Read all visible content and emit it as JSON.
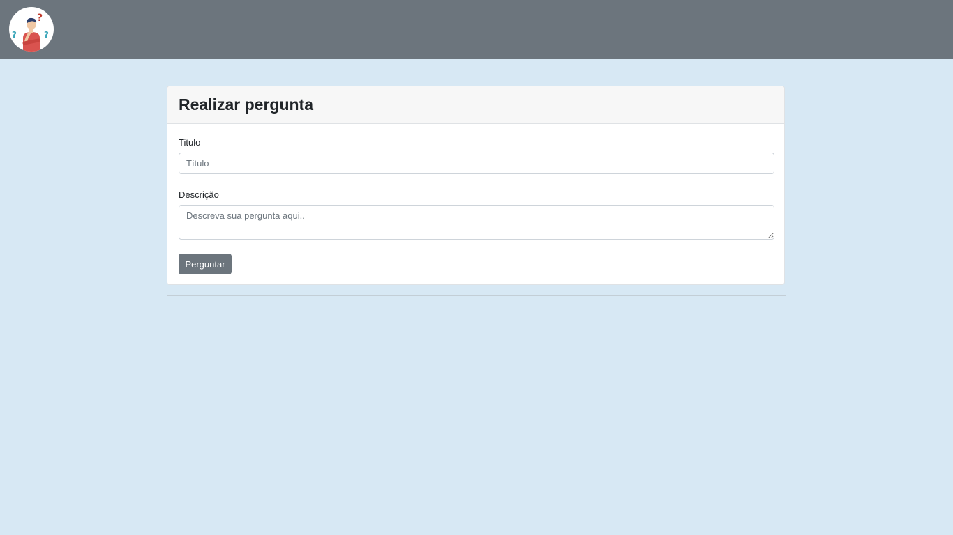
{
  "navbar": {
    "logo_icon": "thinking-person-question-marks-logo",
    "background_color": "#6c757d"
  },
  "form": {
    "heading": "Realizar pergunta",
    "title_label": "Titulo",
    "title_value": "",
    "title_placeholder": "Título",
    "description_label": "Descrição",
    "description_value": "",
    "description_placeholder": "Descreva sua pergunta aqui..",
    "submit_label": "Perguntar"
  },
  "colors": {
    "page_background": "#d7e8f4",
    "button": "#6c757d"
  }
}
